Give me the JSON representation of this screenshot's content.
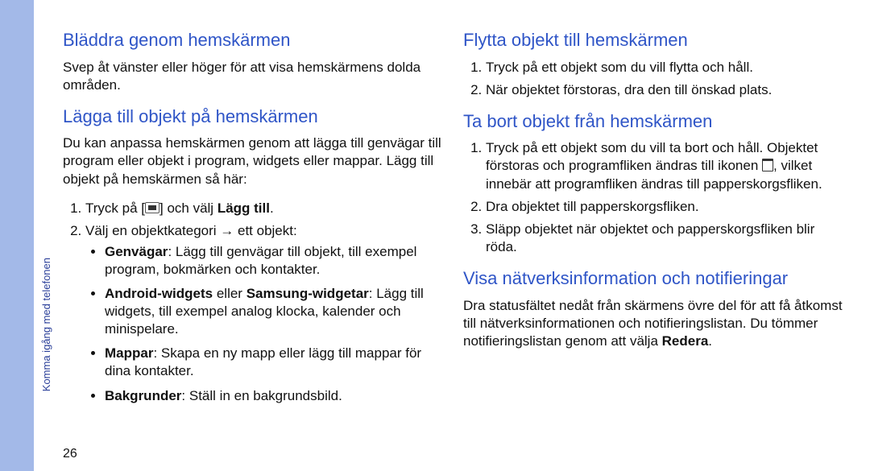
{
  "pageband_label": "Komma igång med telefonen",
  "page_number": "26",
  "left_column": {
    "h1": "Bläddra genom hemskärmen",
    "p1": "Svep åt vänster eller höger för att visa hemskärmens dolda områden.",
    "h2": "Lägga till objekt på hemskärmen",
    "p2": "Du kan anpassa hemskärmen genom att lägga till genvägar till program eller objekt i program, widgets eller mappar. Lägg till objekt på hemskärmen så här:",
    "ol1_1_a": "Tryck på [",
    "ol1_1_b": "] och välj ",
    "ol1_1_c": "Lägg till",
    "ol1_2": "Välj en objektkategori → ett objekt:",
    "bullets": {
      "b1t": "Genvägar",
      "b1": ": Lägg till genvägar till objekt, till exempel program, bokmärken och kontakter.",
      "b2t": "Android-widgets",
      "b2m": " eller ",
      "b2t2": "Samsung-widgetar",
      "b2": ": Lägg till widgets, till exempel analog klocka, kalender och minispelare.",
      "b3t": "Mappar",
      "b3": ": Skapa en ny mapp eller lägg till mappar för dina kontakter.",
      "b4t": "Bakgrunder",
      "b4": ": Ställ in en bakgrundsbild."
    }
  },
  "right_column": {
    "h3": "Flytta objekt till hemskärmen",
    "r_ol1_1": "Tryck på ett objekt som du vill flytta och håll.",
    "r_ol1_2": "När objektet förstoras, dra den till önskad plats.",
    "h4": "Ta bort objekt från hemskärmen",
    "r_ol2_1a": "Tryck på ett objekt som du vill ta bort och håll. Objektet förstoras och programfliken ändras till ikonen ",
    "r_ol2_1b": ", vilket innebär att programfliken ändras till papperskorgsfliken.",
    "r_ol2_2": "Dra objektet till papperskorgsfliken.",
    "r_ol2_3": "Släpp objektet när objektet och papperskorgsfliken blir röda.",
    "h5": "Visa nätverksinformation och notifieringar",
    "p3a": "Dra statusfältet nedåt från skärmens övre del för att få åtkomst till nätverksinformationen och notifieringslistan. Du tömmer notifieringslistan genom att välja ",
    "p3b": "Redera",
    "p3c": "."
  }
}
